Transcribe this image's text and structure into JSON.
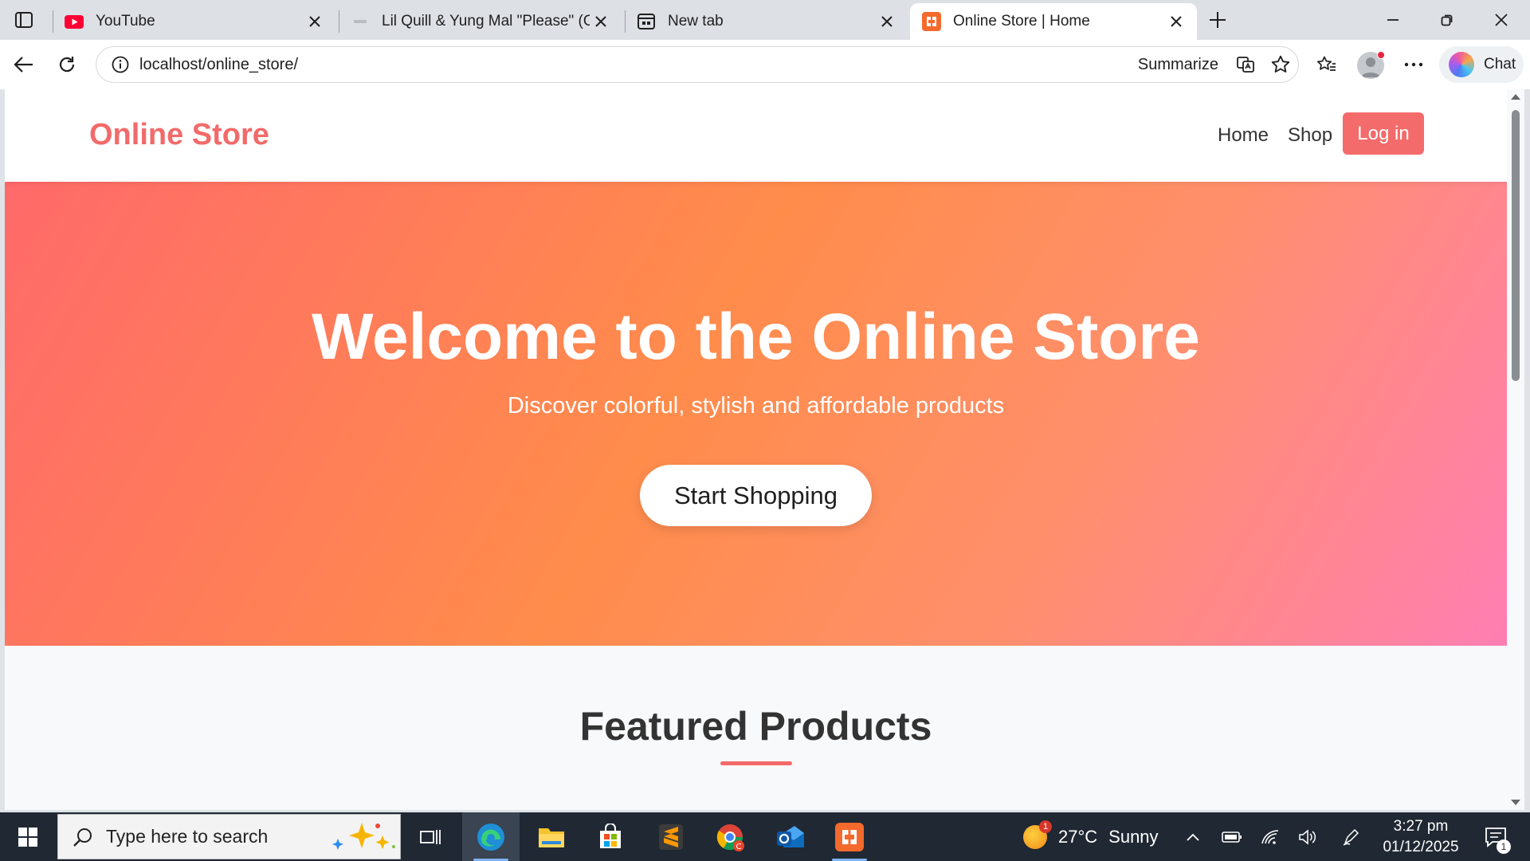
{
  "browser": {
    "tabs": [
      {
        "title": "YouTube",
        "favicon": "youtube-icon",
        "active": false
      },
      {
        "title": "Lil Quill & Yung Mal \"Please\" (Offi",
        "favicon": "video-thumb-icon",
        "active": false
      },
      {
        "title": "New tab",
        "favicon": "newtab-icon",
        "active": false
      },
      {
        "title": "Online Store | Home",
        "favicon": "xampp-icon",
        "active": true
      }
    ],
    "address": "localhost/online_store/",
    "summarize_label": "Summarize",
    "chat_label": "Chat"
  },
  "site": {
    "logo": "Online Store",
    "nav": {
      "home": "Home",
      "shop": "Shop",
      "login": "Log in"
    },
    "hero": {
      "title": "Welcome to the Online Store",
      "subtitle": "Discover colorful, stylish and affordable products",
      "cta": "Start Shopping"
    },
    "featured_title": "Featured Products",
    "colors": {
      "brand": "#f26a6a",
      "hero_start": "#ff6a6a",
      "hero_mid": "#ff8c4b",
      "hero_end": "#ff7eb2"
    }
  },
  "taskbar": {
    "search_placeholder": "Type here to search",
    "weather": {
      "temp": "27°C",
      "condition": "Sunny",
      "badge": "1"
    },
    "time": "3:27 pm",
    "date": "01/12/2025",
    "notification_count": "1"
  }
}
